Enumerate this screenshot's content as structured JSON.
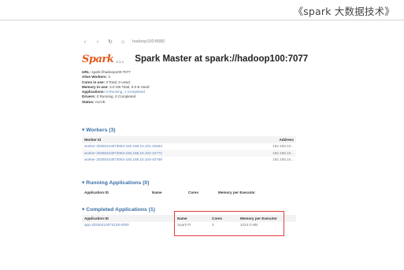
{
  "caption": "《spark 大数据技术》",
  "browser": {
    "back_icon": "‹",
    "forward_icon": "›",
    "reload_icon": "↻",
    "home_icon": "⌂",
    "url": "hadoop100:8080"
  },
  "header": {
    "logo_text": "Spark",
    "logo_version": "2.1.1",
    "title": "Spark Master at spark://hadoop100:7077"
  },
  "info": [
    {
      "key": "URL:",
      "value": "spark://hadoop100:7077"
    },
    {
      "key": "Alive Workers:",
      "value": "3"
    },
    {
      "key": "Cores in use:",
      "value": "3 Total, 0 Used"
    },
    {
      "key": "Memory in use:",
      "value": "3.0 GB Total, 0.0 B Used"
    },
    {
      "key": "Applications:",
      "value": "0 Running, 1 Completed"
    },
    {
      "key": "Drivers:",
      "value": "0 Running, 0 Completed"
    },
    {
      "key": "Status:",
      "value": "ALIVE"
    }
  ],
  "workers": {
    "heading": "▾ Workers (3)",
    "columns": [
      "Worker Id",
      "Address"
    ],
    "rows": [
      {
        "id": "worker-20250410073054-192.168.10.101-42553",
        "address": "192.168.10..."
      },
      {
        "id": "worker-20250410073054-192.168.10.102-42772",
        "address": "192.168.10..."
      },
      {
        "id": "worker-20250410073054-192.168.10.103-40759",
        "address": "192.168.10..."
      }
    ]
  },
  "running": {
    "heading": "▾ Running Applications (0)",
    "columns": [
      "Application ID",
      "Name",
      "Cores",
      "Memory per Executor"
    ]
  },
  "completed": {
    "heading": "▾ Completed Applications (1)",
    "columns": [
      "Application ID",
      "Name",
      "Cores",
      "Memory per Executor"
    ],
    "rows": [
      {
        "id": "app-20250410073128-0000",
        "name": "Spark Pi",
        "cores": "3",
        "memory": "1024.0 MB"
      }
    ]
  }
}
